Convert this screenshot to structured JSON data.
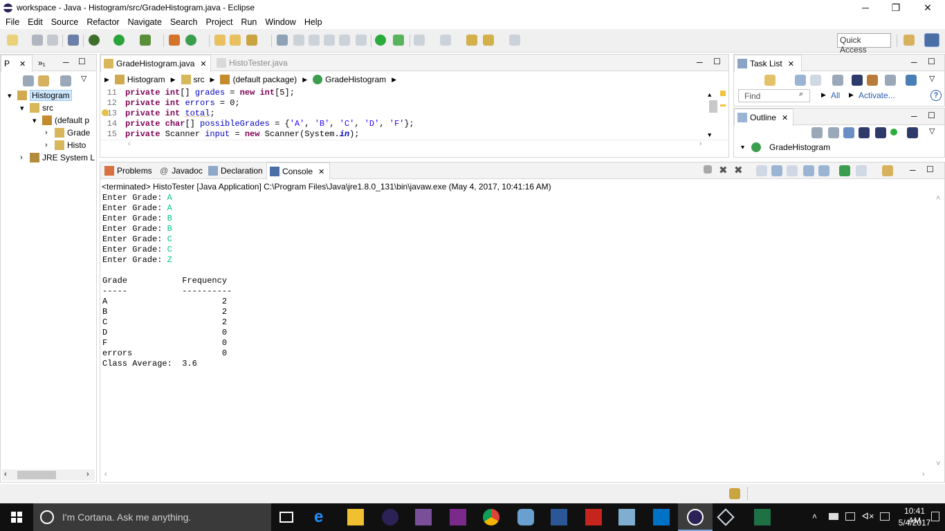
{
  "window": {
    "title": "workspace - Java - Histogram/src/GradeHistogram.java - Eclipse",
    "min": "─",
    "max": "❐",
    "close": "✕"
  },
  "menu": [
    "File",
    "Edit",
    "Source",
    "Refactor",
    "Navigate",
    "Search",
    "Project",
    "Run",
    "Window",
    "Help"
  ],
  "quick_access": "Quick Access",
  "package_explorer": {
    "tabs": [
      "P",
      "»₁"
    ],
    "tree": [
      {
        "label": "Histogram",
        "indent": 0,
        "twisty": "▾",
        "icon": "project-icon",
        "selected": true
      },
      {
        "label": "src",
        "indent": 1,
        "twisty": "▾",
        "icon": "source-folder-icon"
      },
      {
        "label": "(default p",
        "indent": 2,
        "twisty": "▾",
        "icon": "package-icon"
      },
      {
        "label": "Grade",
        "indent": 3,
        "twisty": "›",
        "icon": "java-file-icon"
      },
      {
        "label": "Histo",
        "indent": 3,
        "twisty": "›",
        "icon": "java-file-icon"
      },
      {
        "label": "JRE System L",
        "indent": 1,
        "twisty": "›",
        "icon": "library-icon"
      }
    ]
  },
  "editor": {
    "tabs": [
      {
        "label": "GradeHistogram.java",
        "active": true
      },
      {
        "label": "HistoTester.java",
        "active": false
      }
    ],
    "breadcrumb": [
      "Histogram",
      "src",
      "(default package)",
      "GradeHistogram"
    ],
    "line_numbers": [
      "11",
      "12",
      "13",
      "14",
      "15"
    ]
  },
  "task_list": {
    "title": "Task List",
    "find_placeholder": "Find",
    "all": "All",
    "activate": "Activate...",
    "help": "?"
  },
  "outline": {
    "title": "Outline",
    "root": "GradeHistogram"
  },
  "console": {
    "tabs": [
      "Problems",
      "Javadoc",
      "Declaration",
      "Console"
    ],
    "status": "<terminated> HistoTester [Java Application] C:\\Program Files\\Java\\jre1.8.0_131\\bin\\javaw.exe (May 4, 2017, 10:41:16 AM)",
    "prompt_lines": [
      {
        "prompt": "Enter Grade: ",
        "input": "A"
      },
      {
        "prompt": "Enter Grade: ",
        "input": "A"
      },
      {
        "prompt": "Enter Grade: ",
        "input": "B"
      },
      {
        "prompt": "Enter Grade: ",
        "input": "B"
      },
      {
        "prompt": "Enter Grade: ",
        "input": "C"
      },
      {
        "prompt": "Enter Grade: ",
        "input": "C"
      },
      {
        "prompt": "Enter Grade: ",
        "input": "Z"
      }
    ],
    "output_lines": [
      "",
      "Grade           Frequency",
      "-----           ----------",
      "A                       2",
      "B                       2",
      "C                       2",
      "D                       0",
      "F                       0",
      "errors                  0",
      "Class Average:  3.6"
    ]
  },
  "taskbar": {
    "search": "I'm Cortana. Ask me anything.",
    "time": "10:41 AM",
    "date": "5/4/2017"
  },
  "colors": {
    "keyword": "#7f0055",
    "field": "#0000c0",
    "string": "#2a00ff",
    "console_input": "#00c87d",
    "taskbar": "#101010"
  }
}
